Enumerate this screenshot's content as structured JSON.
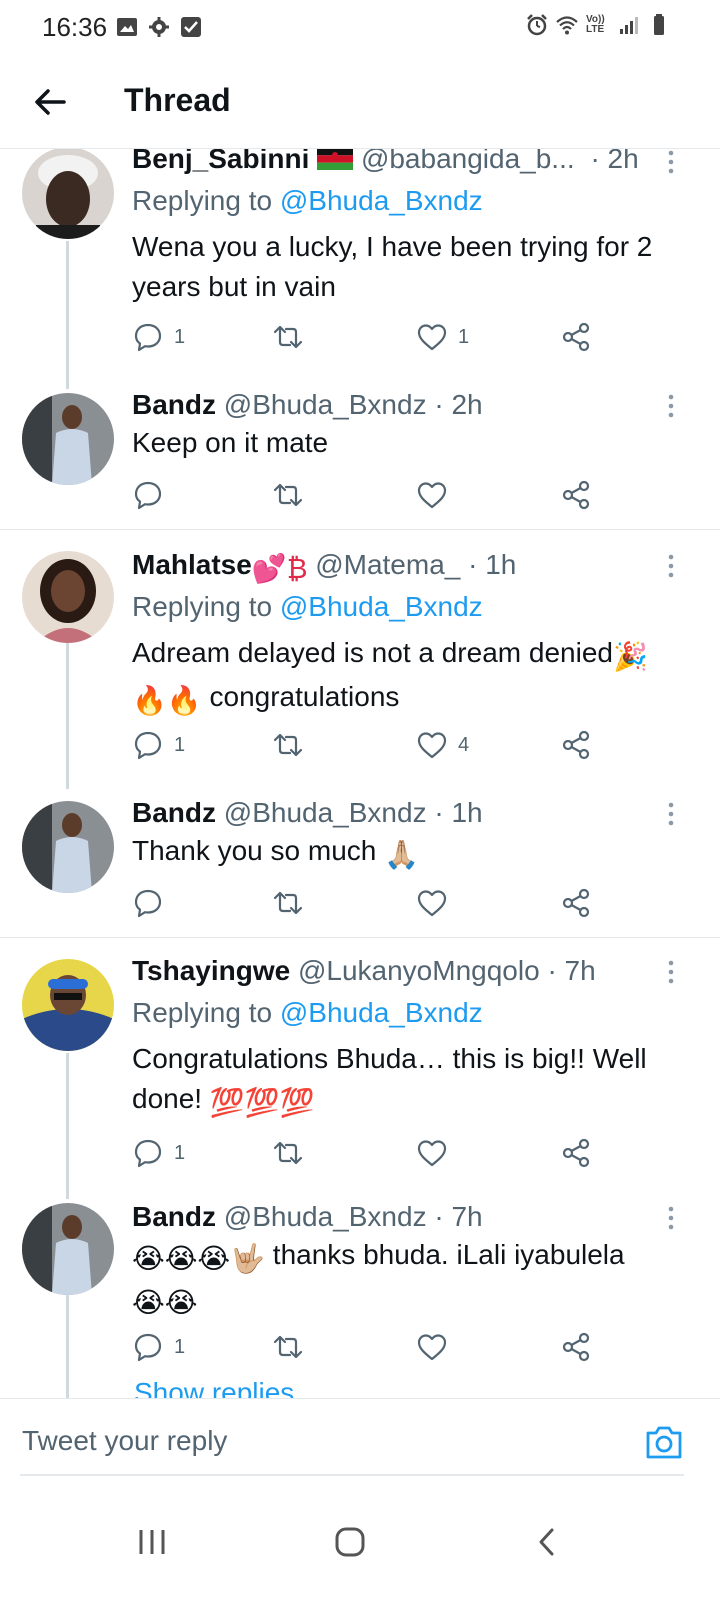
{
  "status": {
    "time": "16:36",
    "network_label": "Vo)) LTE"
  },
  "header": {
    "title": "Thread"
  },
  "tweets": [
    {
      "name": "Benj_Sabinni",
      "flag": "🇲🇼",
      "handle": "@babangida_b...",
      "time": "· 2h",
      "replying_prefix": "Replying to",
      "replying_handle": "@Bhuda_Bxndz",
      "text": "Wena you a lucky, I have been trying for 2 years but in vain",
      "replies": "1",
      "retweets": "",
      "likes": "1"
    },
    {
      "name": "Bandz",
      "handle": "@Bhuda_Bxndz",
      "time": "· 2h",
      "text": "Keep on it mate",
      "replies": "",
      "retweets": "",
      "likes": ""
    },
    {
      "name": "Mahlatse",
      "name_emoji": "💕₿",
      "handle": "@Matema_",
      "time": "· 1h",
      "replying_prefix": "Replying to",
      "replying_handle": "@Bhuda_Bxndz",
      "text_line1": "Adream delayed is not a dream denied",
      "text_emoji1": "🎉",
      "text_emoji2": "🔥🔥",
      "text_line2": "congratulations",
      "replies": "1",
      "retweets": "",
      "likes": "4"
    },
    {
      "name": "Bandz",
      "handle": "@Bhuda_Bxndz",
      "time": "· 1h",
      "text": "Thank you so much",
      "text_emoji": "🙏🏼",
      "replies": "",
      "retweets": "",
      "likes": ""
    },
    {
      "name": "Tshayingwe",
      "handle": "@LukanyoMngqolo",
      "time": "· 7h",
      "replying_prefix": "Replying to",
      "replying_handle": "@Bhuda_Bxndz",
      "text": "Congratulations Bhuda… this is big!! Well done!",
      "text_emoji": "💯💯💯",
      "replies": "1",
      "retweets": "",
      "likes": ""
    },
    {
      "name": "Bandz",
      "handle": "@Bhuda_Bxndz",
      "time": "· 7h",
      "text_emoji1": "😭😭😭🤟🏼",
      "text": "thanks bhuda. iLali iyabulela",
      "text_emoji2": "😭😭",
      "replies": "1",
      "retweets": "",
      "likes": ""
    }
  ],
  "show_replies": "Show replies",
  "compose": {
    "placeholder": "Tweet your reply"
  },
  "colors": {
    "accent": "#1d9bf0",
    "text": "#0f1419",
    "muted": "#536471",
    "divider": "#e6e9eb",
    "thread_line": "#cfd9de"
  }
}
